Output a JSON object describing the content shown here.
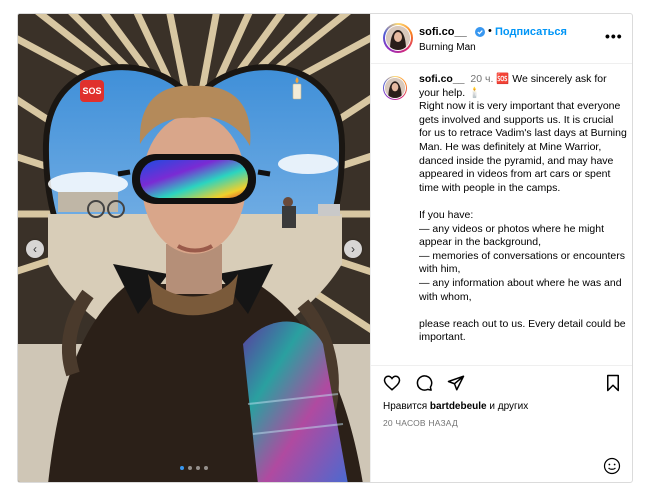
{
  "post": {
    "username": "sofi.co__",
    "location": "Burning Man",
    "follow_label": "Подписаться",
    "separator": "•",
    "more_label": "•••"
  },
  "media": {
    "sos_label": "SOS",
    "slide_count": 4,
    "active_slide": 1
  },
  "caption": {
    "username": "sofi.co__",
    "time": "20 ч.",
    "body": " 🆘 We sincerely ask for your help. 🕯️\nRight now it is very important that everyone gets involved and supports us. It is crucial for us to retrace Vadim's last days at Burning Man. He was definitely at Mine Warrior, danced inside the pyramid, and may have appeared in videos from art cars or spent time with people in the camps.\n\nIf you have:\n— any videos or photos where he might appear in the background,\n— memories of conversations or encounters with him,\n— any information about where he was and with whom,\n\nplease reach out to us. Every detail could be important."
  },
  "actions": {
    "likes_prefix": "Нравится",
    "likes_user": "bartdebeule",
    "likes_suffix": "и других",
    "timestamp": "20 ЧАСОВ НАЗАД"
  },
  "colors": {
    "accent": "#0095f6",
    "verified": "#3897f0",
    "sos": "#e0302c"
  },
  "icons": [
    "chevron-left-icon",
    "chevron-right-icon",
    "verified-icon",
    "more-icon",
    "heart-icon",
    "comment-icon",
    "share-icon",
    "bookmark-icon",
    "emoji-icon",
    "sos-icon",
    "candle-icon"
  ]
}
